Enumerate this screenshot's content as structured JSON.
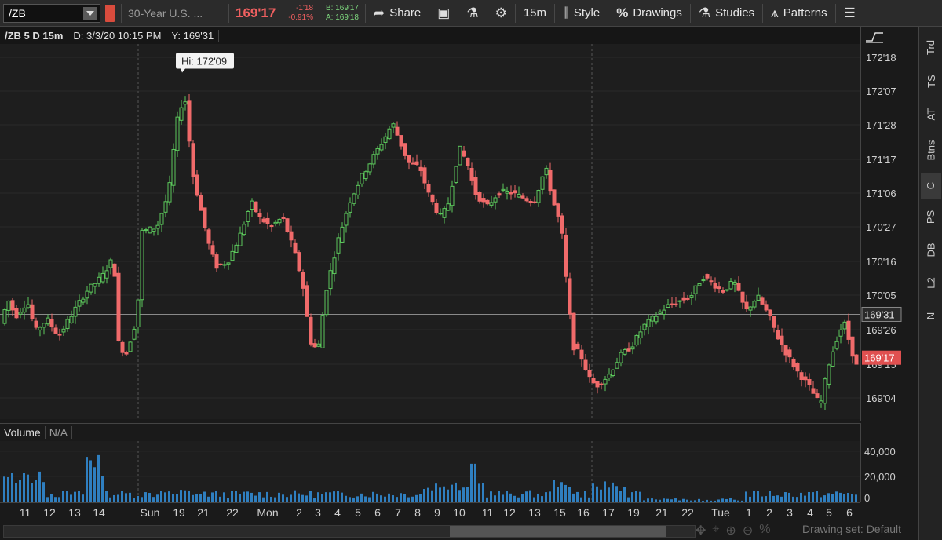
{
  "toolbar": {
    "symbol": "/ZB",
    "description": "30-Year U.S. ...",
    "last": "169'17",
    "change": "-1'18",
    "change_pct": "-0.91%",
    "bid": "B: 169'17",
    "ask": "A: 169'18",
    "share": "Share",
    "timeframe": "15m",
    "style": "Style",
    "drawings": "Drawings",
    "studies": "Studies",
    "patterns": "Patterns"
  },
  "chart_header": {
    "symbol_label": "/ZB 5 D 15m",
    "date": "D: 3/3/20 10:15 PM",
    "y": "Y: 169'31"
  },
  "hi_label": "Hi: 172'09",
  "volume_header": {
    "label": "Volume",
    "value": "N/A"
  },
  "drawing_set": "Drawing set: Default",
  "right_tabs": [
    "Trd",
    "TS",
    "AT",
    "Btns",
    "C",
    "PS",
    "DB",
    "L2",
    "N"
  ],
  "colors": {
    "up": "#5cc85c",
    "down": "#f06a6a",
    "volume": "#2f7fc0",
    "cursor_label_bg": "#3a3a3a",
    "last_label_bg": "#e05050"
  },
  "chart_data": {
    "type": "candlestick",
    "price_ticks": [
      "172'18",
      "172'07",
      "171'28",
      "171'17",
      "171'06",
      "170'27",
      "170'16",
      "170'05",
      "169'26",
      "169'15",
      "169'04"
    ],
    "cursor_price": "169'31",
    "last_price": "169'17",
    "volume_ticks": [
      "40,000",
      "20,000",
      "0"
    ],
    "time_labels": [
      "11",
      "12",
      "13",
      "14",
      "Sun",
      "19",
      "21",
      "22",
      "Mon",
      "2",
      "3",
      "4",
      "5",
      "6",
      "7",
      "8",
      "9",
      "10",
      "11",
      "12",
      "13",
      "15",
      "16",
      "17",
      "19",
      "21",
      "22",
      "Tue",
      "1",
      "2",
      "3",
      "4",
      "5",
      "6"
    ],
    "high": "172'09",
    "price_range": [
      169.0,
      172.72
    ],
    "volume_range": [
      0,
      48000
    ]
  }
}
